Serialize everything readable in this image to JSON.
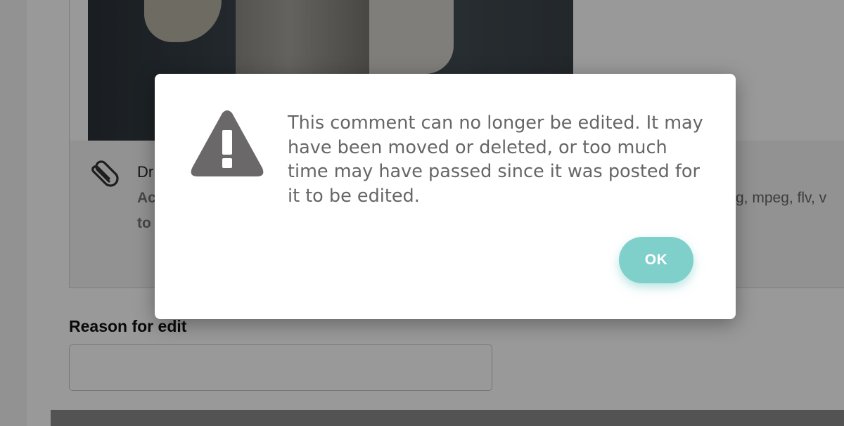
{
  "background": {
    "attachment": {
      "title_fragment": "Dr",
      "accept_fragment": "Ac",
      "tail_fragment": "to",
      "formats_fragment": "g, mpeg, flv, v"
    },
    "reason": {
      "label": "Reason for edit",
      "value": ""
    }
  },
  "dialog": {
    "icon": "warning-triangle-icon",
    "message": "This comment can no longer be edited. It may have been moved or deleted, or too much time may have passed since it was posted for it to be edited.",
    "ok_label": "OK"
  },
  "colors": {
    "ok_button": "#7fcfcb",
    "icon": "#6b6869",
    "message_text": "#666666",
    "overlay": "rgba(0,0,0,0.40)"
  }
}
